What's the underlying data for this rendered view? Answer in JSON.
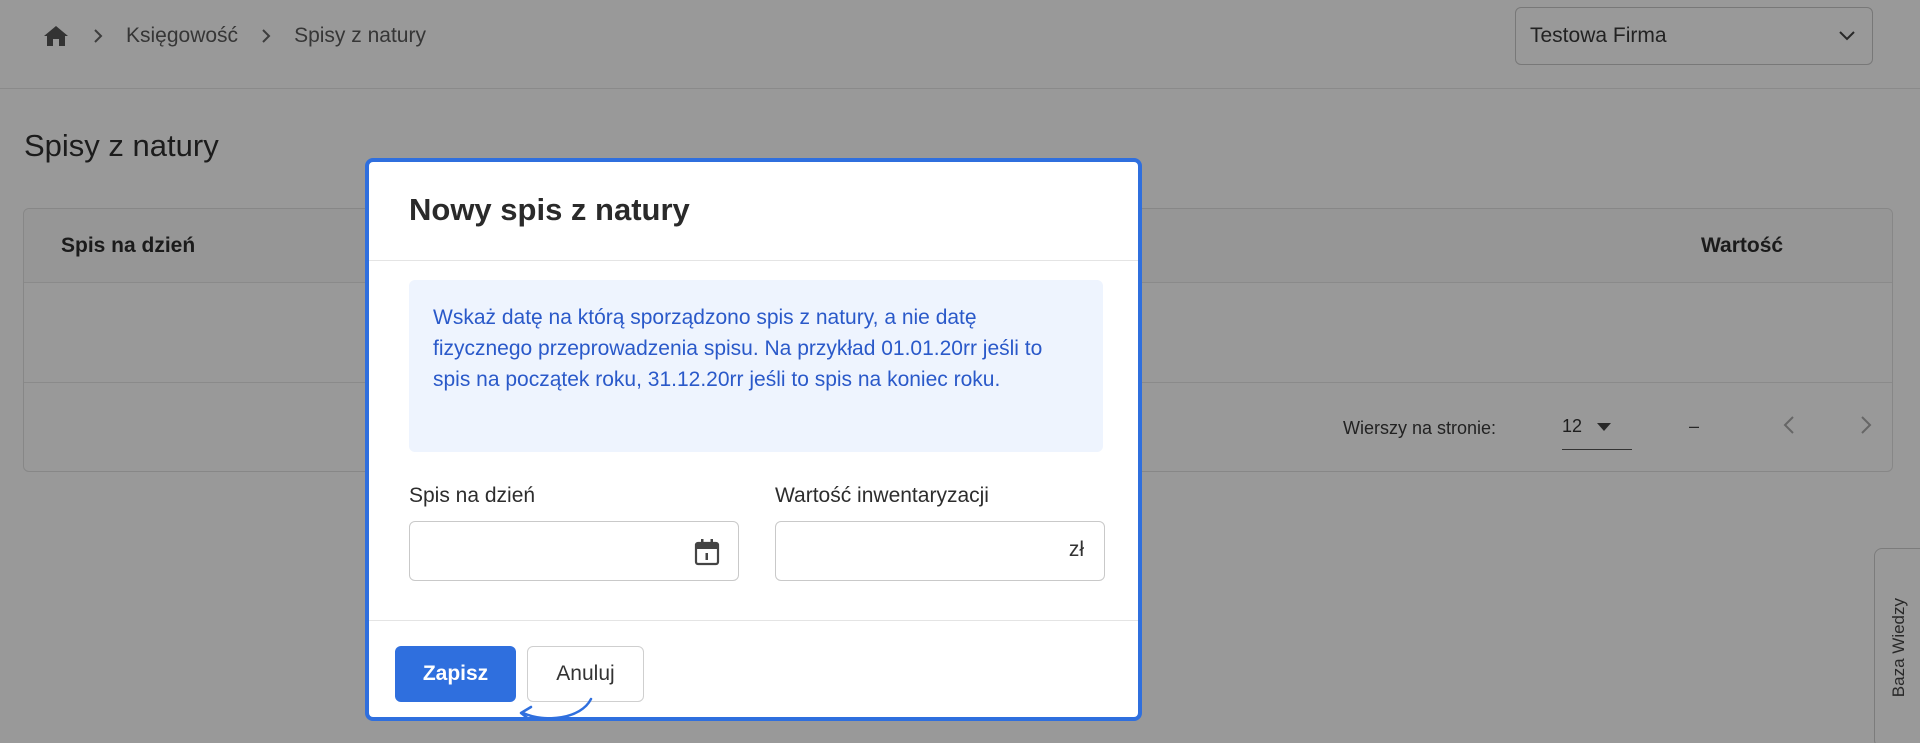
{
  "breadcrumb": {
    "items": [
      "Księgowość",
      "Spisy z natury"
    ]
  },
  "company_select": {
    "value": "Testowa Firma"
  },
  "page": {
    "title": "Spisy z natury"
  },
  "table": {
    "columns": [
      "Spis na dzień",
      "Wartość"
    ],
    "pagination": {
      "rows_per_page_label": "Wierszy na stronie:",
      "rows_per_page_value": "12",
      "range": "–"
    }
  },
  "knowledge_base_tab": {
    "label": "Baza Wiedzy"
  },
  "modal": {
    "title": "Nowy spis z natury",
    "info_text": "Wskaż datę na którą sporządzono spis z natury, a nie datę fizycznego przeprowadzenia spisu. Na przykład 01.01.20rr jeśli to spis na początek roku, 31.12.20rr jeśli to spis na koniec roku.",
    "date_field": {
      "label": "Spis na dzień",
      "value": ""
    },
    "value_field": {
      "label": "Wartość inwentaryzacji",
      "value": "",
      "suffix": "zł"
    },
    "save_label": "Zapisz",
    "cancel_label": "Anuluj"
  },
  "colors": {
    "accent": "#2f6fde",
    "info_bg": "#eef4fe",
    "info_text": "#2a59c9"
  },
  "icons": [
    "home-icon",
    "chevron-right-icon",
    "chevron-down-icon",
    "caret-down-icon",
    "chevron-left-icon",
    "calendar-icon",
    "curved-arrow-icon"
  ]
}
